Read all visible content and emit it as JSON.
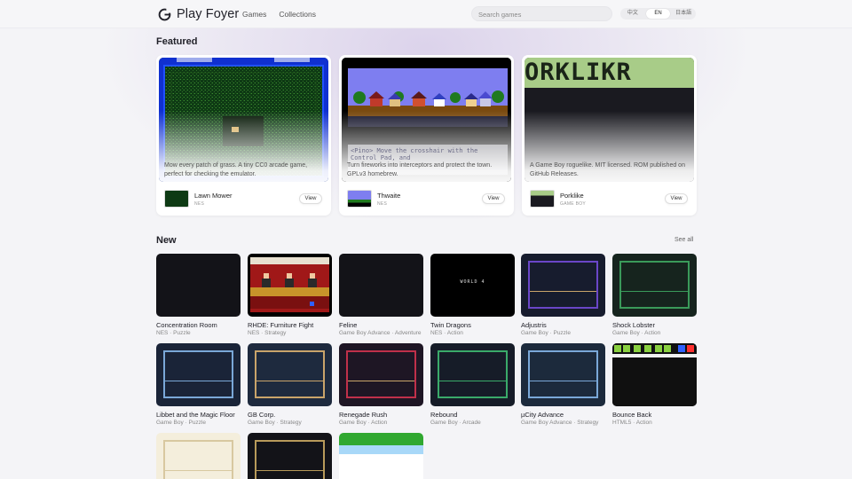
{
  "header": {
    "brand": "Play Foyer",
    "nav": [
      "Games",
      "Collections"
    ],
    "search_placeholder": "Search games",
    "languages": [
      "中文",
      "EN",
      "日本語"
    ],
    "active_language": "EN"
  },
  "featured": {
    "title": "Featured",
    "cards": [
      {
        "name": "Lawn Mower",
        "platform": "NES",
        "description": "Mow every patch of grass. A tiny CC0 arcade game, perfect for checking the emulator.",
        "button": "View"
      },
      {
        "name": "Thwaite",
        "platform": "NES",
        "description": "Turn fireworks into interceptors and protect the town. GPLv3 homebrew.",
        "button": "View",
        "screen_text": "<Pino> Move the crosshair with the Control Pad, and"
      },
      {
        "name": "Porklike",
        "platform": "GAME BOY",
        "description": "A Game Boy roguelike. MIT licensed. ROM published on GitHub Releases.",
        "button": "View",
        "screen_text": "ORKLIKR"
      }
    ]
  },
  "new": {
    "title": "New",
    "see_all": "See all",
    "games": [
      {
        "name": "Concentration Room",
        "meta": "NES · Puzzle"
      },
      {
        "name": "RHDE: Furniture Fight",
        "meta": "NES · Strategy"
      },
      {
        "name": "Feline",
        "meta": "Game Boy Advance · Adventure"
      },
      {
        "name": "Twin Dragons",
        "meta": "NES · Action",
        "screen_text": "WORLD 4"
      },
      {
        "name": "Adjustris",
        "meta": "Game Boy · Puzzle"
      },
      {
        "name": "Shock Lobster",
        "meta": "Game Boy · Action"
      },
      {
        "name": "Libbet and the Magic Floor",
        "meta": "Game Boy · Puzzle"
      },
      {
        "name": "GB Corp.",
        "meta": "Game Boy · Strategy"
      },
      {
        "name": "Renegade Rush",
        "meta": "Game Boy · Action"
      },
      {
        "name": "Rebound",
        "meta": "Game Boy · Arcade"
      },
      {
        "name": "µCity Advance",
        "meta": "Game Boy Advance · Strategy"
      },
      {
        "name": "Bounce Back",
        "meta": "HTML5 · Action"
      },
      {
        "name": "",
        "meta": ""
      },
      {
        "name": "",
        "meta": ""
      },
      {
        "name": "",
        "meta": ""
      }
    ]
  },
  "colors": {
    "accent": "#7b4fd0",
    "frame_blue": "#4a80c0",
    "frame_purple": "#6a46c8",
    "frame_green": "#3a9a5a",
    "frame_gold": "#c9a46a",
    "frame_red": "#c0304a"
  }
}
